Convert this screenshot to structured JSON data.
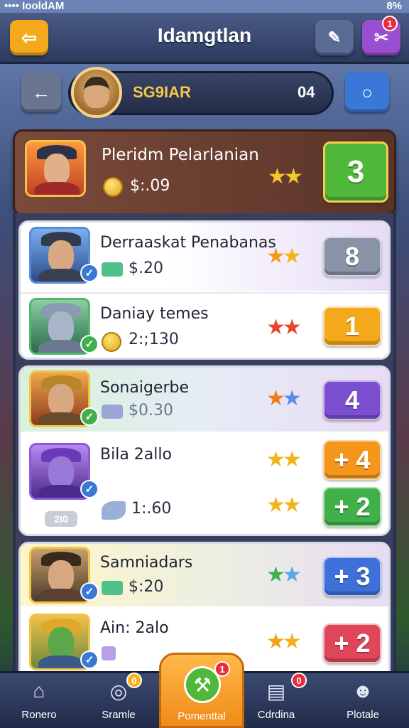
{
  "status": {
    "left": "•••• IooldAM",
    "right": "8%"
  },
  "header": {
    "title": "Idamgtlan",
    "notif_count": "1"
  },
  "profile": {
    "name": "SG9IAR",
    "score": "04"
  },
  "featured": {
    "name": "Pleridm Pelarlanian",
    "value": "$:.09",
    "badge": "3",
    "stars": 2
  },
  "rows": [
    {
      "name": "Derraaskat Penabanas",
      "value": "$.20",
      "badge": "8",
      "badge_color": "#8a92a8",
      "star_colors": [
        "#f29a1a",
        "#f2b41a"
      ]
    },
    {
      "name": "Daniay temes",
      "value": "2:;130",
      "badge": "1",
      "badge_color": "#f4a81c",
      "star_colors": [
        "#e8452a",
        "#e8452a"
      ]
    },
    {
      "name": "Sonaigerbe",
      "value": "$0.30",
      "badge": "4",
      "badge_color": "#7b4fd0",
      "star_colors": [
        "#f27a1a",
        "#5b8ae8"
      ]
    },
    {
      "name": "Bila 2allo",
      "value": "1:.60",
      "badge": "+ 4",
      "badge_color": "#f4961c",
      "star_colors": [
        "#f2b41a",
        "#f2b41a"
      ]
    },
    {
      "name": "",
      "value": "",
      "badge": "+ 2",
      "badge_color": "#3fb04a",
      "star_colors": [
        "#f2b41a",
        "#f2b41a"
      ]
    },
    {
      "name": "Samniadars",
      "value": "$:20",
      "badge": "+ 3",
      "badge_color": "#3f6fd8",
      "star_colors": [
        "#3fb04a",
        "#5ba8e8"
      ]
    },
    {
      "name": "Ain: 2alo",
      "value": "",
      "badge": "+ 2",
      "badge_color": "#e0465a",
      "star_colors": [
        "#f2a01a",
        "#f2b41a"
      ]
    }
  ],
  "level_tag": "2I0",
  "nav": [
    {
      "label": "Ronero"
    },
    {
      "label": "Sramle",
      "count": "0"
    },
    {
      "label": "Pomenttal",
      "count": "1"
    },
    {
      "label": "Cdrdina",
      "count": "0"
    },
    {
      "label": "Plotale"
    }
  ],
  "colors": {
    "accent": "#f08a18",
    "panel": "#3a3f5e",
    "header": "#2c3a5f"
  }
}
